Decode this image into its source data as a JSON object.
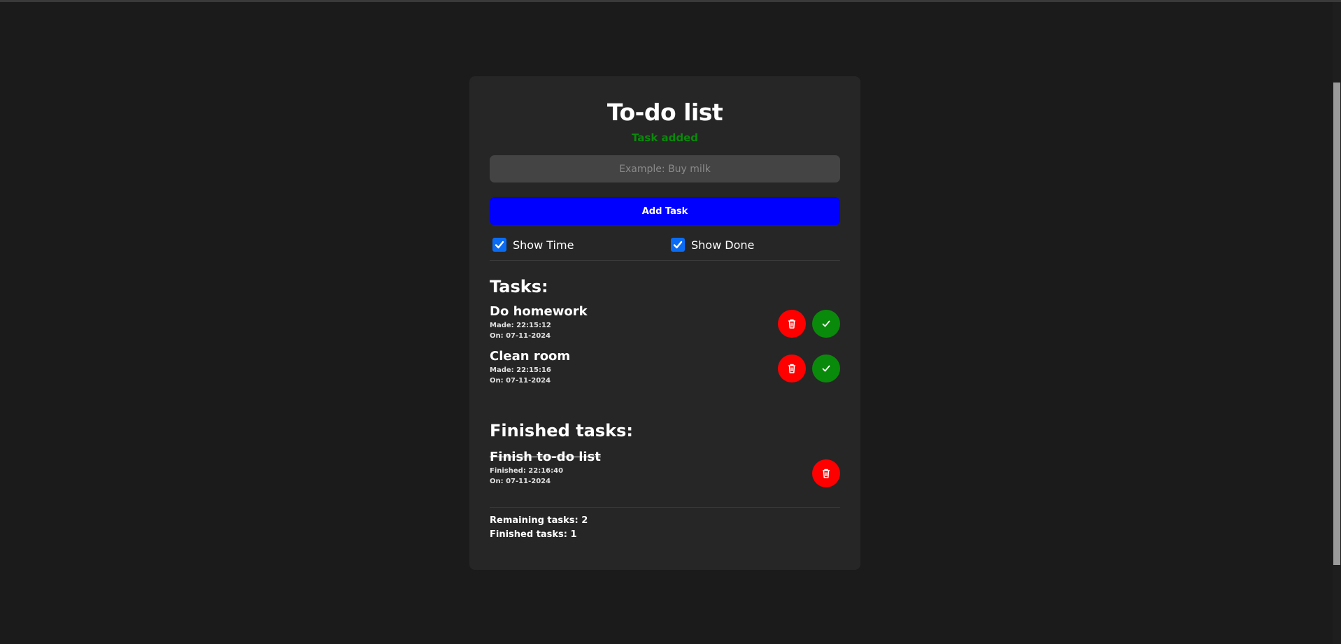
{
  "app": {
    "title": "To-do list",
    "status_message": "Task added",
    "status_color": "#0a8a0a"
  },
  "input": {
    "value": "",
    "placeholder": "Example: Buy milk"
  },
  "add_button": {
    "label": "Add Task",
    "color": "#0000ff"
  },
  "options": {
    "show_time": {
      "label": "Show Time",
      "checked": true
    },
    "show_done": {
      "label": "Show Done",
      "checked": true
    }
  },
  "tasks": {
    "heading": "Tasks:",
    "items": [
      {
        "name": "Do homework",
        "made": "Made: 22:15:12",
        "on": "On: 07-11-2024",
        "delete_icon": "trash-icon",
        "complete_icon": "check-icon"
      },
      {
        "name": "Clean room",
        "made": "Made: 22:15:16",
        "on": "On: 07-11-2024",
        "delete_icon": "trash-icon",
        "complete_icon": "check-icon"
      }
    ]
  },
  "finished": {
    "heading": "Finished tasks:",
    "items": [
      {
        "name": "Finish to-do list",
        "finished": "Finished: 22:16:40",
        "on": "On: 07-11-2024",
        "delete_icon": "trash-icon"
      }
    ]
  },
  "summary": {
    "remaining": "Remaining tasks: 2",
    "finished": "Finished tasks: 1"
  },
  "colors": {
    "background": "#1b1b1b",
    "card": "#262626",
    "delete": "#ff0000",
    "complete": "#0a8a0a"
  }
}
